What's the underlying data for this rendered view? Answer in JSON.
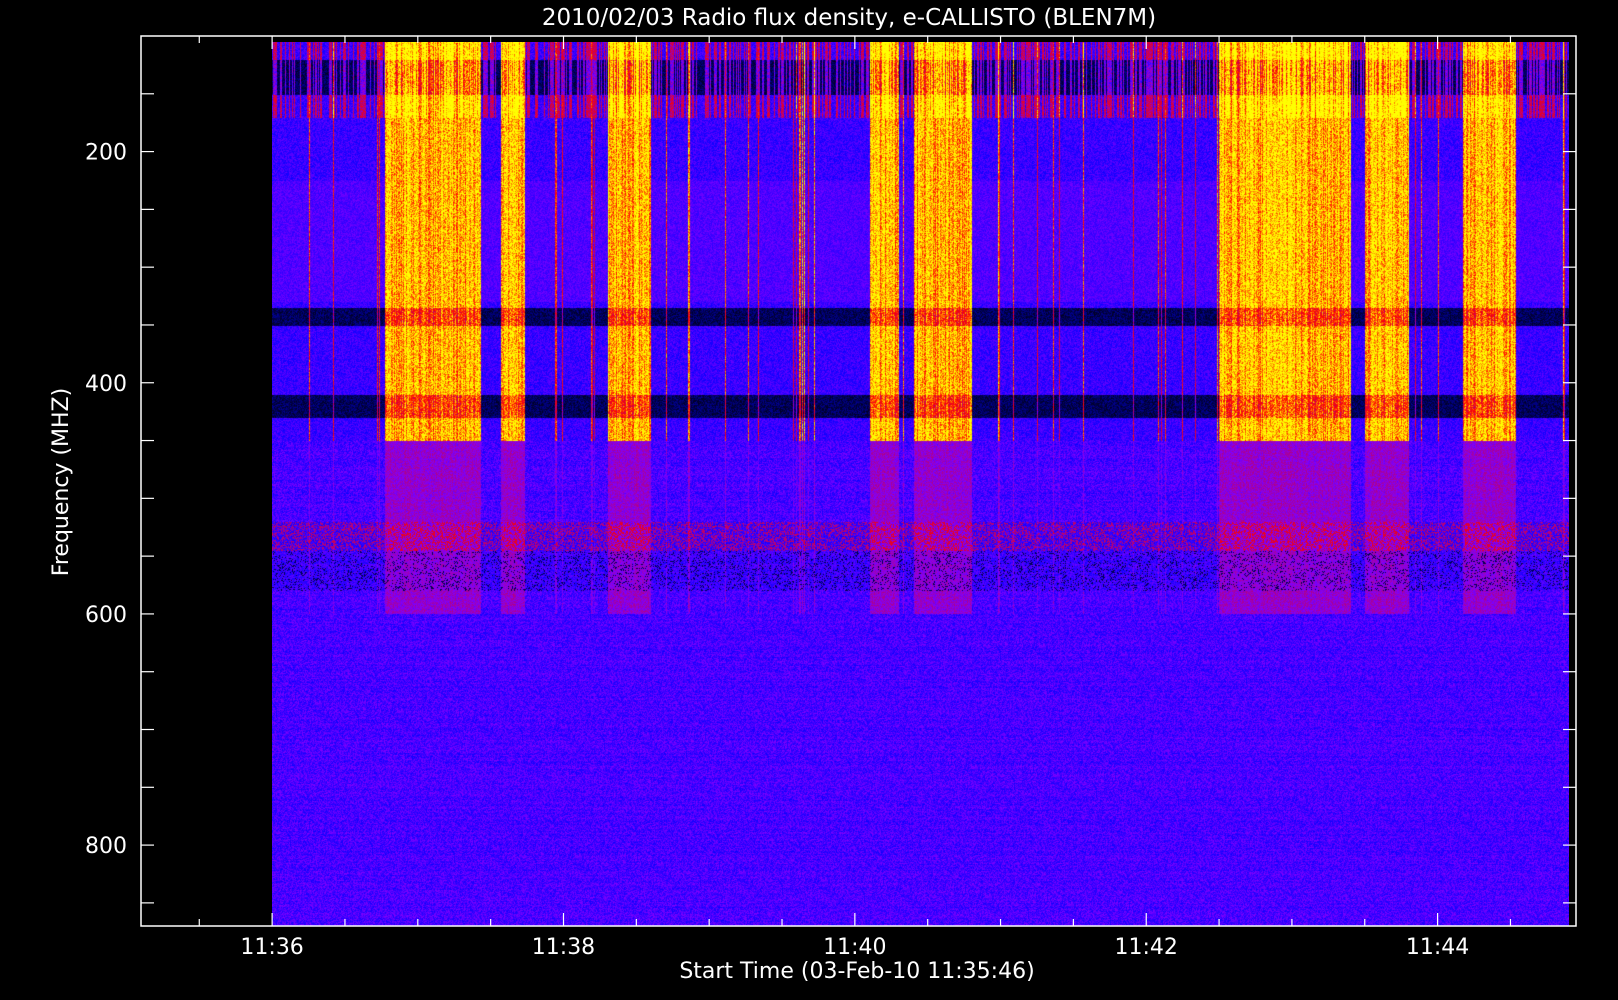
{
  "chart_data": {
    "type": "heatmap",
    "title": "2010/02/03  Radio flux density, e-CALLISTO (BLEN7M)",
    "xlabel": "Start Time (03-Feb-10 11:35:46)",
    "ylabel": "Frequency (MHZ)",
    "x_ticks": [
      "11:36",
      "11:38",
      "11:40",
      "11:42",
      "11:44"
    ],
    "x_tick_minutes": [
      36,
      38,
      40,
      42,
      44
    ],
    "x_range_minutes": [
      35.1,
      44.95
    ],
    "y_ticks": [
      "200",
      "400",
      "600",
      "800"
    ],
    "y_tick_values": [
      200,
      400,
      600,
      800
    ],
    "y_range_mhz": [
      100,
      870
    ],
    "y_reversed": true,
    "data_range": {
      "time_minutes": [
        36.0,
        44.9
      ],
      "frequency_mhz": [
        105,
        870
      ]
    },
    "colormap": [
      "#000000",
      "#0000ff",
      "#8000ff",
      "#c00060",
      "#ff0000",
      "#ff8000",
      "#ffff00"
    ],
    "burst_times_minutes": [
      37.1,
      37.65,
      38.45,
      40.2,
      40.6,
      42.8,
      43.1,
      43.65,
      44.35
    ],
    "burst_widths_minutes": [
      0.33,
      0.08,
      0.15,
      0.1,
      0.2,
      0.3,
      0.3,
      0.15,
      0.18
    ],
    "dark_band_frequencies_mhz": [
      [
        120,
        150
      ],
      [
        335,
        350
      ],
      [
        410,
        430
      ]
    ]
  }
}
